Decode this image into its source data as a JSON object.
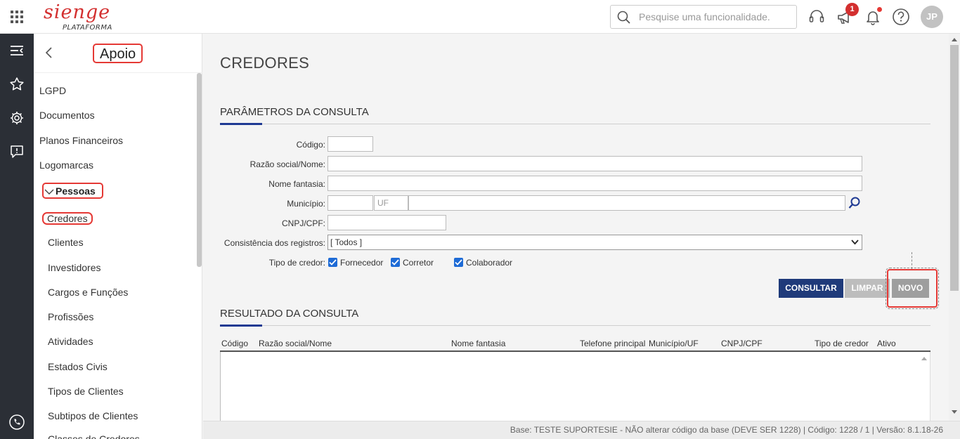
{
  "header": {
    "logo_text": "sienge",
    "logo_subtitle": "PLATAFORMA",
    "search_placeholder": "Pesquise uma funcionalidade.",
    "notification_count": "1",
    "user_initials": "JP",
    "brand_color": "#d32f2f"
  },
  "rail": {
    "icons": [
      "menu-collapse-icon",
      "star-icon",
      "gear-icon",
      "feedback-icon",
      "phone-icon"
    ]
  },
  "sidebar": {
    "title": "Apoio",
    "items": [
      "LGPD",
      "Documentos",
      "Planos Financeiros",
      "Logomarcas"
    ],
    "group_label": "Pessoas",
    "sub_items": [
      "Credores",
      "Clientes",
      "Investidores",
      "Cargos e Funções",
      "Profissões",
      "Atividades",
      "Estados Civis",
      "Tipos de Clientes",
      "Subtipos de Clientes",
      "Classes de Credores"
    ]
  },
  "main": {
    "page_title": "CREDORES",
    "params_title": "PARÂMETROS DA CONSULTA",
    "labels": {
      "codigo": "Código:",
      "razao": "Razão social/Nome:",
      "fantasia": "Nome fantasia:",
      "municipio": "Município:",
      "cnpj": "CNPJ/CPF:",
      "consistencia": "Consistência dos registros:",
      "tipo": "Tipo de credor:"
    },
    "uf_placeholder": "UF",
    "consistencia_value": "[ Todos ]",
    "tipo_options": [
      "Fornecedor",
      "Corretor",
      "Colaborador"
    ],
    "buttons": {
      "consultar": "CONSULTAR",
      "limpar": "LIMPAR",
      "novo": "NOVO"
    },
    "results_title": "RESULTADO DA CONSULTA",
    "columns": [
      "Código",
      "Razão social/Nome",
      "Nome fantasia",
      "Telefone principal",
      "Município/UF",
      "CNPJ/CPF",
      "Tipo de credor",
      "Ativo"
    ]
  },
  "footer": {
    "status": "Base: TESTE SUPORTESIE - NÃO alterar código da base (DEVE SER 1228) | Código: 1228 / 1 | Versão: 8.1.18-26"
  }
}
